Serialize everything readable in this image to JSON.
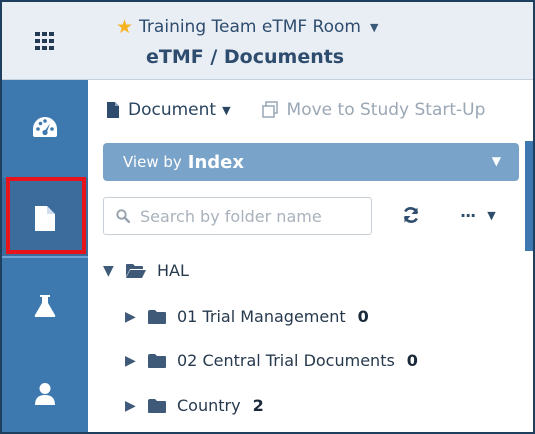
{
  "header": {
    "room_name": "Training Team eTMF Room",
    "breadcrumb": "eTMF / Documents"
  },
  "colors": {
    "rail": "#3d79af",
    "rail_active": "#3b6c9b",
    "header_bg": "#e9eef5",
    "text_dark": "#2e4d6e",
    "viewby_bg": "#7aa3c9",
    "star": "#f5b323",
    "highlight": "#e8141b"
  },
  "nav": {
    "icons": [
      "grid-icon",
      "dashboard-icon",
      "document-icon",
      "flask-icon",
      "user-icon"
    ],
    "active": "document-icon"
  },
  "toolbar": {
    "document_label": "Document",
    "move_label": "Move to Study Start-Up"
  },
  "viewby": {
    "prefix": "View by",
    "value": "Index"
  },
  "search": {
    "placeholder": "Search by folder name"
  },
  "tree": {
    "root": {
      "label": "HAL",
      "expanded": true
    },
    "children": [
      {
        "label": "01 Trial Management",
        "count": "0"
      },
      {
        "label": "02 Central Trial Documents",
        "count": "0"
      },
      {
        "label": "Country",
        "count": "2"
      }
    ]
  }
}
